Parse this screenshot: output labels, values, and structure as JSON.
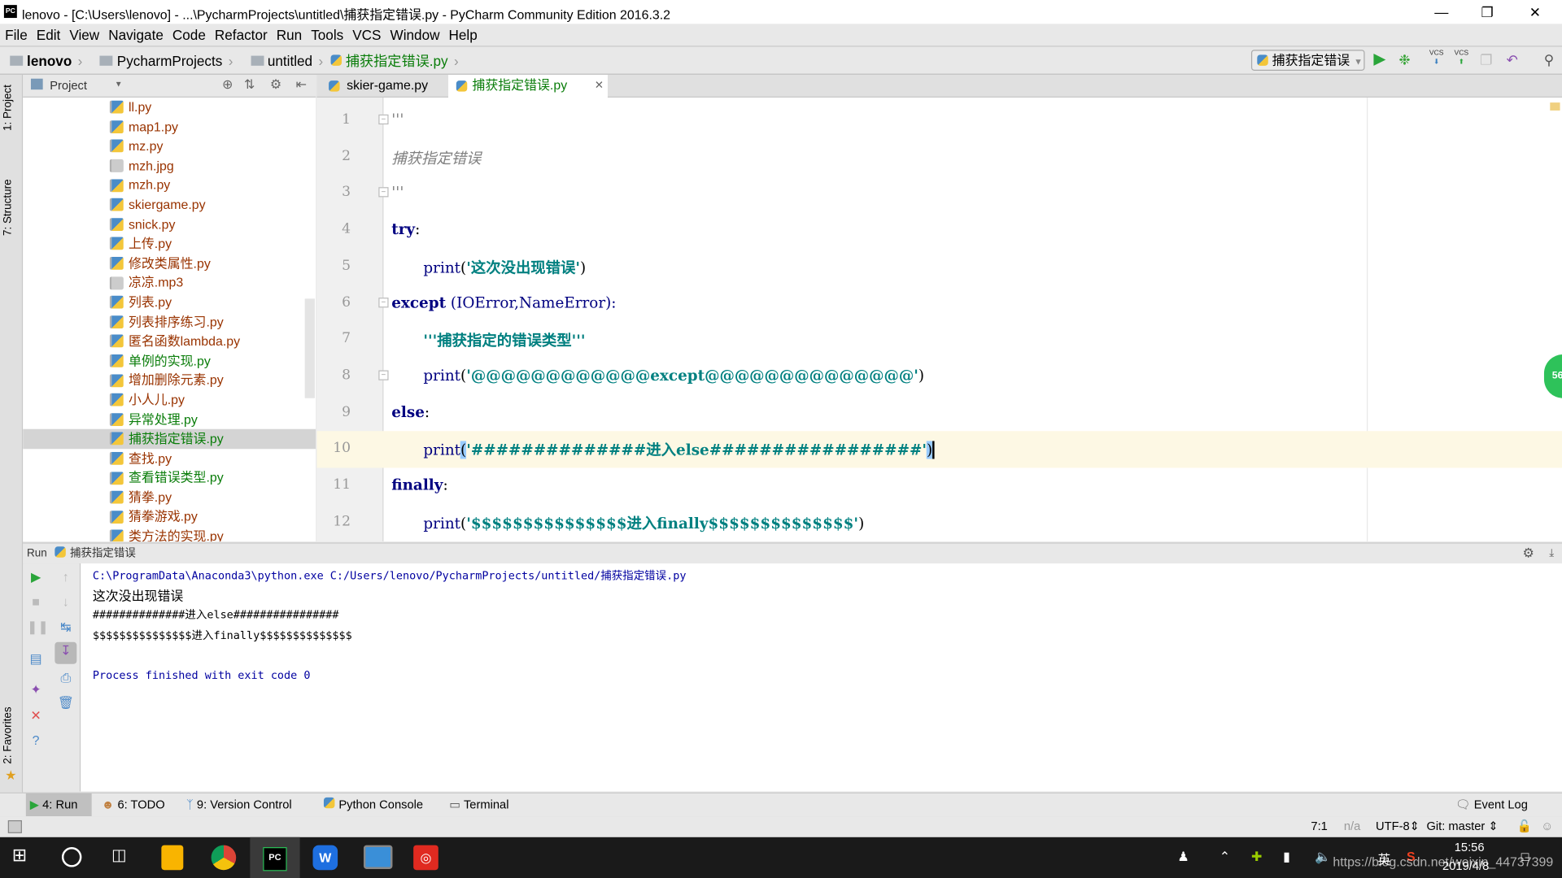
{
  "window": {
    "title": "lenovo - [C:\\Users\\lenovo] - ...\\PycharmProjects\\untitled\\捕获指定错误.py - PyCharm Community Edition 2016.3.2",
    "app_icon": "PC"
  },
  "menu": [
    "File",
    "Edit",
    "View",
    "Navigate",
    "Code",
    "Refactor",
    "Run",
    "Tools",
    "VCS",
    "Window",
    "Help"
  ],
  "breadcrumb": [
    "lenovo",
    "PycharmProjects",
    "untitled",
    "捕获指定错误.py"
  ],
  "toolbar": {
    "run_config": "捕获指定错误",
    "vcs": "VCS"
  },
  "sidebar": {
    "project_tab": "1: Project",
    "structure_tab": "7: Structure",
    "favorites_tab": "2: Favorites"
  },
  "project": {
    "header": "Project",
    "files": [
      {
        "name": "ll.py",
        "status": "unversioned"
      },
      {
        "name": "map1.py",
        "status": "unversioned"
      },
      {
        "name": "mz.py",
        "status": "unversioned"
      },
      {
        "name": "mzh.jpg",
        "status": "unversioned"
      },
      {
        "name": "mzh.py",
        "status": "unversioned"
      },
      {
        "name": "skiergame.py",
        "status": "unversioned"
      },
      {
        "name": "snick.py",
        "status": "unversioned"
      },
      {
        "name": "上传.py",
        "status": "unversioned"
      },
      {
        "name": "修改类属性.py",
        "status": "unversioned"
      },
      {
        "name": "凉凉.mp3",
        "status": "unversioned"
      },
      {
        "name": "列表.py",
        "status": "unversioned"
      },
      {
        "name": "列表排序练习.py",
        "status": "unversioned"
      },
      {
        "name": "匿名函数lambda.py",
        "status": "unversioned"
      },
      {
        "name": "单例的实现.py",
        "status": "added"
      },
      {
        "name": "增加删除元素.py",
        "status": "unversioned"
      },
      {
        "name": "小人儿.py",
        "status": "unversioned"
      },
      {
        "name": "异常处理.py",
        "status": "added"
      },
      {
        "name": "捕获指定错误.py",
        "status": "added",
        "selected": true
      },
      {
        "name": "查找.py",
        "status": "unversioned"
      },
      {
        "name": "查看错误类型.py",
        "status": "added"
      },
      {
        "name": "猜拳.py",
        "status": "unversioned"
      },
      {
        "name": "猜拳游戏.py",
        "status": "unversioned"
      },
      {
        "name": "类方法的实现.py",
        "status": "unversioned"
      }
    ]
  },
  "tabs": [
    {
      "label": "skier-game.py",
      "active": false
    },
    {
      "label": "捕获指定错误.py",
      "active": true
    }
  ],
  "code": {
    "l1": "'''",
    "l2": "捕获指定错误",
    "l3": "'''",
    "l4_kw": "try",
    "l4_p": ":",
    "l5_fn": "print",
    "l5_s": "'这次没出现错误'",
    "l6_kw": "except",
    "l6_rest": " (IOError,NameError):",
    "l7": "'''捕获指定的错误类型'''",
    "l8_fn": "print",
    "l8_s": "'@@@@@@@@@@@@except@@@@@@@@@@@@@@'",
    "l9_kw": "else",
    "l9_p": ":",
    "l10_fn": "print",
    "l10_s": "'##############进入else#################'",
    "l11_kw": "finally",
    "l11_p": ":",
    "l12_fn": "print",
    "l12_s": "'$$$$$$$$$$$$$$$进入finally$$$$$$$$$$$$$$'",
    "open": "(",
    "close": ")"
  },
  "line_numbers": [
    "1",
    "2",
    "3",
    "4",
    "5",
    "6",
    "7",
    "8",
    "9",
    "10",
    "11",
    "12"
  ],
  "inspection_badge": "56",
  "run": {
    "header": "Run",
    "config": "捕获指定错误",
    "output": [
      "C:\\ProgramData\\Anaconda3\\python.exe C:/Users/lenovo/PycharmProjects/untitled/捕获指定错误.py",
      "这次没出现错误",
      "##############进入else################",
      "$$$$$$$$$$$$$$$进入finally$$$$$$$$$$$$$$",
      "",
      "Process finished with exit code 0"
    ]
  },
  "bottom_tabs": [
    "4: Run",
    "6: TODO",
    "9: Version Control",
    "Python Console",
    "Terminal"
  ],
  "event_log": "Event Log",
  "status": {
    "position": "7:1",
    "na": "n/a",
    "encoding": "UTF-8",
    "git": "Git: master"
  },
  "taskbar": {
    "time": "15:56",
    "date": "2019/4/8",
    "ime": "英",
    "watermark": "https://blog.csdn.net/weixin_44737399"
  },
  "colors": {
    "keyword": "#000080",
    "string": "#008080",
    "unversioned": "#993300",
    "added": "#0a7d0a",
    "caret_row": "#fdf8e4"
  }
}
